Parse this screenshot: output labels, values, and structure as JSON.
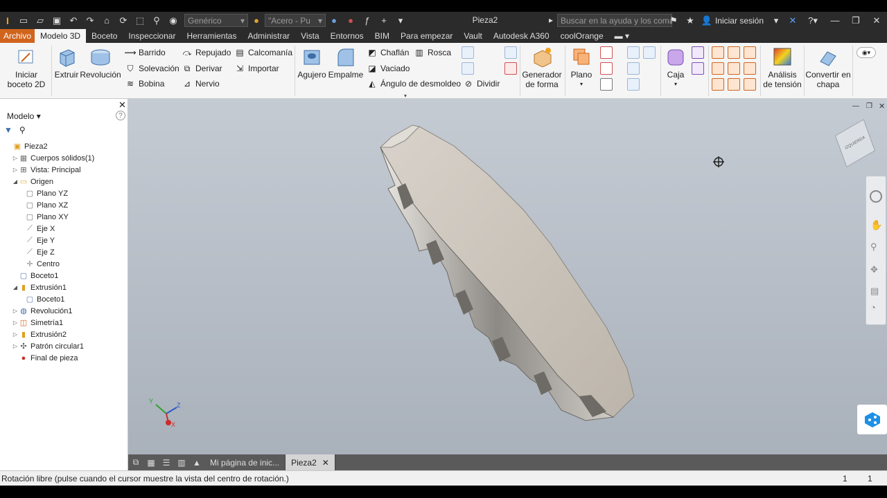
{
  "title_bar": {
    "material_style": "Genérico",
    "material": "\"Acero - Pu",
    "document_title": "Pieza2",
    "search_placeholder": "Buscar en la ayuda y los comandos",
    "sign_in": "Iniciar sesión"
  },
  "tabs": [
    "Archivo",
    "Modelo 3D",
    "Boceto",
    "Inspeccionar",
    "Herramientas",
    "Administrar",
    "Vista",
    "Entornos",
    "BIM",
    "Para empezar",
    "Vault",
    "Autodesk A360",
    "coolOrange"
  ],
  "active_tab": "Modelo 3D",
  "ribbon": {
    "start_sketch": "Iniciar boceto 2D",
    "extrude": "Extruir",
    "revolve": "Revolución",
    "sweep": "Barrido",
    "loft": "Solevación",
    "coil": "Bobina",
    "emboss": "Repujado",
    "derive": "Derivar",
    "rib": "Nervio",
    "decal": "Calcomanía",
    "import": "Importar",
    "hole": "Agujero",
    "fillet": "Empalme",
    "chamfer": "Chaflán",
    "thread": "Rosca",
    "shell": "Vaciado",
    "draft": "Ángulo de desmoldeo",
    "split": "Dividir",
    "shape_generator": "Generador de forma",
    "plane": "Plano",
    "box": "Caja",
    "stress_analysis": "Análisis de tensión",
    "convert_sheet": "Convertir en chapa"
  },
  "browser": {
    "title": "Modelo",
    "tree": [
      {
        "label": "Pieza2",
        "level": 0,
        "expander": "",
        "icon": "part-icon"
      },
      {
        "label": "Cuerpos sólidos(1)",
        "level": 1,
        "expander": "▷",
        "icon": "solid-bodies-icon"
      },
      {
        "label": "Vista: Principal",
        "level": 1,
        "expander": "▷",
        "icon": "view-rep-icon"
      },
      {
        "label": "Origen",
        "level": 1,
        "expander": "◢",
        "icon": "folder-icon"
      },
      {
        "label": "Plano YZ",
        "level": 2,
        "expander": "",
        "icon": "plane-icon"
      },
      {
        "label": "Plano XZ",
        "level": 2,
        "expander": "",
        "icon": "plane-icon"
      },
      {
        "label": "Plano XY",
        "level": 2,
        "expander": "",
        "icon": "plane-icon"
      },
      {
        "label": "Eje X",
        "level": 2,
        "expander": "",
        "icon": "axis-icon"
      },
      {
        "label": "Eje Y",
        "level": 2,
        "expander": "",
        "icon": "axis-icon"
      },
      {
        "label": "Eje Z",
        "level": 2,
        "expander": "",
        "icon": "axis-icon"
      },
      {
        "label": "Centro",
        "level": 2,
        "expander": "",
        "icon": "center-point-icon"
      },
      {
        "label": "Boceto1",
        "level": 1,
        "expander": "",
        "icon": "sketch-icon"
      },
      {
        "label": "Extrusión1",
        "level": 1,
        "expander": "◢",
        "icon": "extrude-feature-icon"
      },
      {
        "label": "Boceto1",
        "level": 2,
        "expander": "",
        "icon": "sketch-icon"
      },
      {
        "label": "Revolución1",
        "level": 1,
        "expander": "▷",
        "icon": "revolve-feature-icon"
      },
      {
        "label": "Simetría1",
        "level": 1,
        "expander": "▷",
        "icon": "mirror-feature-icon"
      },
      {
        "label": "Extrusión2",
        "level": 1,
        "expander": "▷",
        "icon": "extrude-feature-icon"
      },
      {
        "label": "Patrón circular1",
        "level": 1,
        "expander": "▷",
        "icon": "circular-pattern-icon"
      },
      {
        "label": "Final de pieza",
        "level": 1,
        "expander": "",
        "icon": "end-of-part-icon"
      }
    ]
  },
  "viewcube_label": "IZQUIERDA",
  "document_tabs": [
    "Mi página de inic...",
    "Pieza2"
  ],
  "active_document": "Pieza2",
  "status": {
    "message": "Rotación libre (pulse cuando el cursor muestre la vista del centro de rotación.)",
    "count1": "1",
    "count2": "1"
  },
  "colors": {
    "accent_file_tab": "#d0641d",
    "ribbon_bg": "#f5f5f5",
    "viewport_top": "#c5cbd3",
    "viewport_bottom": "#a9b1bb",
    "gear": "#c9c2b8"
  }
}
